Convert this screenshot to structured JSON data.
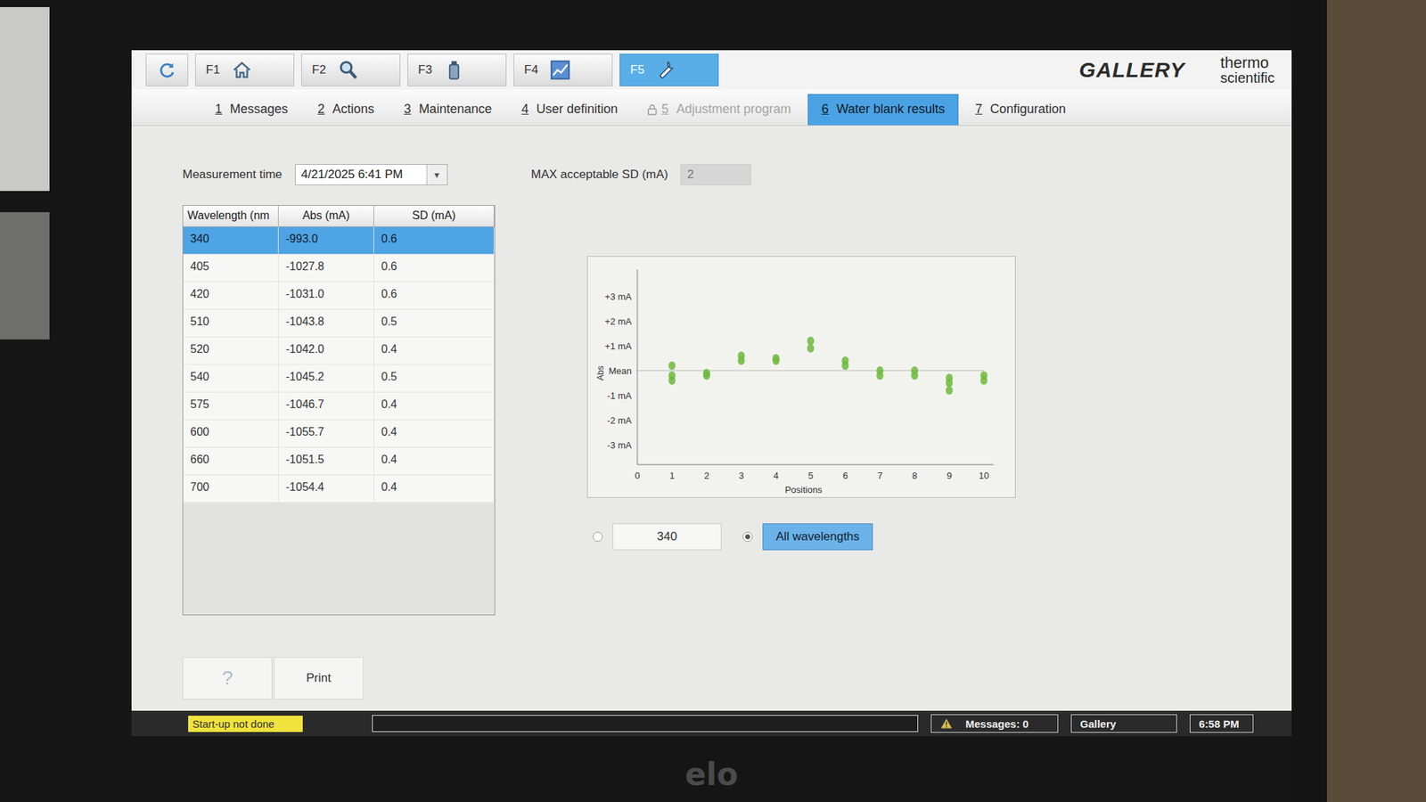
{
  "monitor": {
    "brand": "elo"
  },
  "toolbar": {
    "buttons": [
      {
        "key": "",
        "icon": "refresh",
        "selected": false
      },
      {
        "key": "F1",
        "icon": "home",
        "selected": false
      },
      {
        "key": "F2",
        "icon": "search",
        "selected": false
      },
      {
        "key": "F3",
        "icon": "bottle",
        "selected": false
      },
      {
        "key": "F4",
        "icon": "chart",
        "selected": false
      },
      {
        "key": "F5",
        "icon": "wrench",
        "selected": true
      }
    ],
    "brand": "GALLERY",
    "vendor": [
      "thermo",
      "scientific"
    ]
  },
  "tabs": [
    {
      "key": "1",
      "label": "Messages",
      "selected": false,
      "disabled": false,
      "locked": false
    },
    {
      "key": "2",
      "label": "Actions",
      "selected": false,
      "disabled": false,
      "locked": false
    },
    {
      "key": "3",
      "label": "Maintenance",
      "selected": false,
      "disabled": false,
      "locked": false
    },
    {
      "key": "4",
      "label": "User definition",
      "selected": false,
      "disabled": false,
      "locked": false
    },
    {
      "key": "5",
      "label": "Adjustment program",
      "selected": false,
      "disabled": true,
      "locked": true
    },
    {
      "key": "6",
      "label": "Water blank results",
      "selected": true,
      "disabled": false,
      "locked": false
    },
    {
      "key": "7",
      "label": "Configuration",
      "selected": false,
      "disabled": false,
      "locked": false
    }
  ],
  "measurement": {
    "label": "Measurement time",
    "value": "4/21/2025 6:41 PM",
    "dropdown": "▾"
  },
  "max_sd": {
    "label": "MAX acceptable SD (mA)",
    "value": "2",
    "disabled": true
  },
  "table": {
    "columns": [
      "Wavelength (nm",
      "Abs (mA)",
      "SD (mA)"
    ],
    "rows": [
      {
        "cells": [
          "340",
          "-993.0",
          "0.6"
        ],
        "selected": true
      },
      {
        "cells": [
          "405",
          "-1027.8",
          "0.6"
        ],
        "selected": false
      },
      {
        "cells": [
          "420",
          "-1031.0",
          "0.6"
        ],
        "selected": false
      },
      {
        "cells": [
          "510",
          "-1043.8",
          "0.5"
        ],
        "selected": false
      },
      {
        "cells": [
          "520",
          "-1042.0",
          "0.4"
        ],
        "selected": false
      },
      {
        "cells": [
          "540",
          "-1045.2",
          "0.5"
        ],
        "selected": false
      },
      {
        "cells": [
          "575",
          "-1046.7",
          "0.4"
        ],
        "selected": false
      },
      {
        "cells": [
          "600",
          "-1055.7",
          "0.4"
        ],
        "selected": false
      },
      {
        "cells": [
          "660",
          "-1051.5",
          "0.4"
        ],
        "selected": false
      },
      {
        "cells": [
          "700",
          "-1054.4",
          "0.4"
        ],
        "selected": false
      }
    ]
  },
  "chart": {
    "y_label": "Abs",
    "x_label": "Positions",
    "y_ticks": [
      {
        "label": "+3 mA",
        "value": 3
      },
      {
        "label": "+2 mA",
        "value": 2
      },
      {
        "label": "+1 mA",
        "value": 1
      },
      {
        "label": "Mean",
        "value": 0
      },
      {
        "label": "-1 mA",
        "value": -1
      },
      {
        "label": "-2 mA",
        "value": -2
      },
      {
        "label": "-3 mA",
        "value": -3
      }
    ],
    "x_ticks": [
      "0",
      "1",
      "2",
      "3",
      "4",
      "5",
      "6",
      "7",
      "8",
      "9",
      "10"
    ],
    "series": [
      {
        "name": "All wavelengths",
        "color": "#6dbb3c",
        "points": [
          {
            "position": 1,
            "values": [
              0.2,
              -0.2,
              -0.4
            ]
          },
          {
            "position": 2,
            "values": [
              -0.1,
              -0.2
            ]
          },
          {
            "position": 3,
            "values": [
              0.6,
              0.4
            ]
          },
          {
            "position": 4,
            "values": [
              0.5,
              0.4
            ]
          },
          {
            "position": 5,
            "values": [
              1.2,
              0.9
            ]
          },
          {
            "position": 6,
            "values": [
              0.4,
              0.2
            ]
          },
          {
            "position": 7,
            "values": [
              0.0,
              -0.2
            ]
          },
          {
            "position": 8,
            "values": [
              0.0,
              -0.2
            ]
          },
          {
            "position": 9,
            "values": [
              -0.3,
              -0.5,
              -0.8
            ]
          },
          {
            "position": 10,
            "values": [
              -0.2,
              -0.4
            ]
          }
        ]
      }
    ]
  },
  "view_options": [
    {
      "label": "340",
      "selected": false
    },
    {
      "label": "All wavelengths",
      "selected": true
    }
  ],
  "bottom_buttons": [
    "?",
    "Print"
  ],
  "status_bar": {
    "startup": "Start-up not done",
    "progress": 0,
    "messages": "Messages: 0",
    "system": "Gallery",
    "time": "6:58 PM"
  }
}
